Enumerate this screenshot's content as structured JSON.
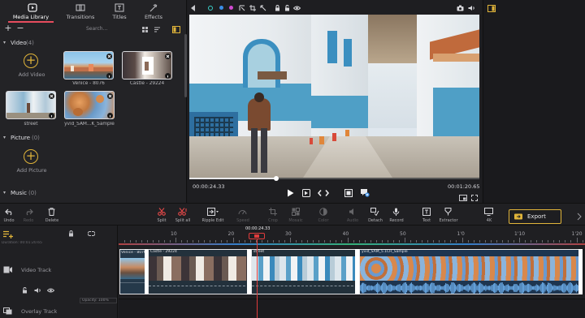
{
  "library": {
    "tabs": [
      {
        "label": "Media Library",
        "icon": "media-library-icon"
      },
      {
        "label": "Transitions",
        "icon": "transitions-icon"
      },
      {
        "label": "Titles",
        "icon": "titles-icon"
      },
      {
        "label": "Effects",
        "icon": "effects-icon"
      }
    ],
    "search_placeholder": "Search...",
    "video": {
      "title": "Video",
      "count": "(4)",
      "add_label": "Add Video",
      "items": [
        {
          "name": "Venice - 8076"
        },
        {
          "name": "Castle - 29224"
        },
        {
          "name": "street"
        },
        {
          "name": "yvid_SAM...K_Sample"
        }
      ]
    },
    "picture": {
      "title": "Picture",
      "count": "(0)",
      "add_label": "Add Picture"
    },
    "music": {
      "title": "Music",
      "count": "(0)"
    }
  },
  "preview": {
    "current_time": "00:00:24.33",
    "total_time": "00:01:20.65",
    "progress": 0.3
  },
  "toolbar": {
    "undo": "Undo",
    "redo": "Redo",
    "delete": "Delete",
    "split": "Split",
    "split_all": "Split all",
    "ripple_edit": "Ripple Edit",
    "speed": "Speed",
    "crop": "Crop",
    "mosaic": "Mosaic",
    "color": "Color",
    "audio": "Audio",
    "detach": "Detach",
    "record": "Record",
    "text": "Text",
    "extractor": "Extractor",
    "resolution": "4K",
    "export": "Export"
  },
  "timeline": {
    "playhead_time": "00:00:24.33",
    "ruler": [
      "10",
      "20",
      "30",
      "40",
      "50",
      "1'0",
      "1'10",
      "1'20"
    ],
    "duration_label": "Duration: 00:01:20.65",
    "video_track": {
      "label": "Video Track",
      "opacity": "Opacity: 100%",
      "clips": [
        {
          "name": "Venice - 8076"
        },
        {
          "name": "Castle - 29224"
        },
        {
          "name": "street"
        },
        {
          "name": "yvid_SAM_5.1CH_Sample"
        }
      ]
    },
    "overlay_track": {
      "label": "Overlay Track"
    }
  },
  "colors": {
    "accent": "#3a8ee6",
    "export_border": "#e0b43a",
    "playhead": "#e03c3c",
    "split": "#e04848"
  }
}
